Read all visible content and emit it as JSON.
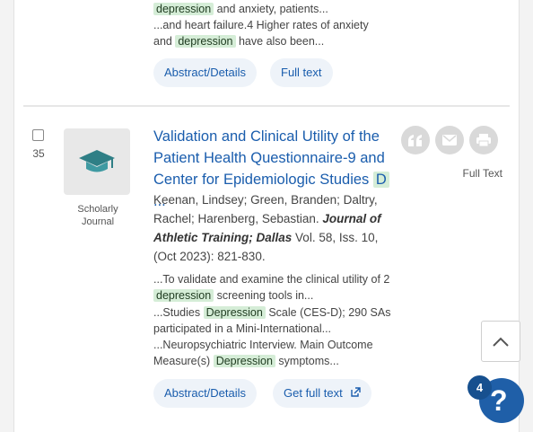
{
  "prev_result": {
    "snippet_line1_hl": "depression",
    "snippet_line1_rest": "and anxiety, patients...",
    "snippet_line2": "...and heart failure.4 Higher rates of anxiety",
    "snippet_line3_pre": "and",
    "snippet_line3_hl": "depression",
    "snippet_line3_rest": "have also been...",
    "abstract_label": "Abstract/Details",
    "fulltext_label": "Full text"
  },
  "result": {
    "number": "35",
    "type_label": "Scholarly Journal",
    "title": "Validation and Clinical Utility of the Patient Health Questionnaire-9 and Center for Epidemiologic Studies",
    "title_trunc_letter": "D",
    "title_ellipsis": "...",
    "authors": "Keenan, Lindsey; Green, Branden; Daltry, Rachel; Harenberg, Sebastian.",
    "journal": "Journal of Athletic Training; Dallas",
    "citation": "Vol. 58, Iss. 10, (Oct 2023): 821-830.",
    "s1_pre": "...To validate and examine the clinical utility of 2",
    "s1_hl": "depression",
    "s1_rest": "screening tools in...",
    "s2_pre": "...Studies",
    "s2_hl": "Depression",
    "s2_rest": "Scale (CES-D); 290 SAs participated in a Mini-International...",
    "s3_pre": "...Neuropsychiatric Interview. Main Outcome Measure(s)",
    "s3_hl": "Depression",
    "s3_rest": "symptoms...",
    "abstract_label": "Abstract/Details",
    "get_fulltext_label": "Get full text",
    "fulltext_caption": "Full Text"
  },
  "help": {
    "badge_count": "4",
    "symbol": "?"
  },
  "icons": {
    "cite": "quote-icon",
    "email": "email-icon",
    "print": "print-icon",
    "scroll_top": "chevron-up-icon",
    "external": "external-link-icon"
  },
  "colors": {
    "link": "#1a5dad",
    "highlight": "#d5edd7",
    "help": "#1f5fa8"
  }
}
